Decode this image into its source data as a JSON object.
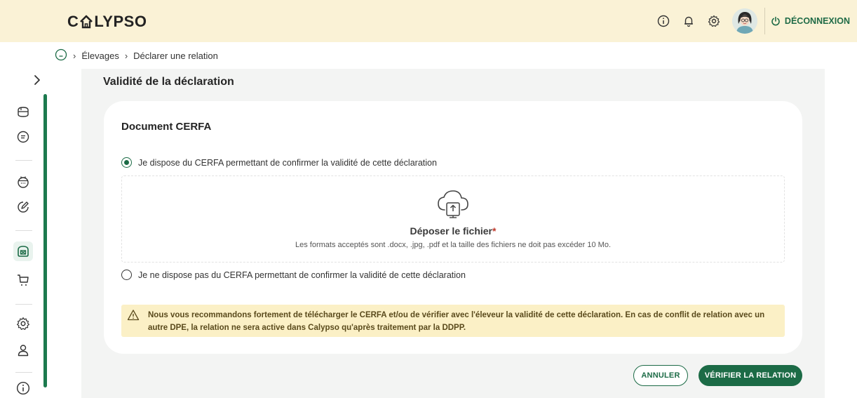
{
  "app": {
    "logo_left": "C",
    "logo_right": "LYPSO"
  },
  "header": {
    "logout_label": "DÉCONNEXION",
    "icons": [
      "info-icon",
      "bell-icon",
      "gear-icon",
      "avatar",
      "power-icon"
    ]
  },
  "breadcrumb": {
    "items": [
      "Élevages",
      "Déclarer une relation"
    ]
  },
  "sidebar": {
    "icons": [
      "chevron-right-icon",
      "briefcase-icon",
      "document-icon",
      "calendar-icon",
      "edit-icon",
      "barn-icon",
      "cart-icon",
      "gear-icon",
      "user-icon",
      "info-icon"
    ]
  },
  "main": {
    "section_title": "Validité de la déclaration",
    "card": {
      "title": "Document CERFA",
      "option_yes": "Je dispose du CERFA permettant de confirmer la validité de cette déclaration",
      "option_no": "Je ne dispose pas du CERFA permettant de confirmer la validité de cette déclaration",
      "selected": "yes",
      "dropzone": {
        "title": "Déposer le fichier",
        "required_mark": "*",
        "hint": "Les formats acceptés sont .docx, .jpg, .pdf et la taille des fichiers ne doit pas excéder 10 Mo."
      },
      "warning": "Nous vous recommandons fortement de télécharger le CERFA et/ou de vérifier avec l'éleveur la validité de cette déclaration. En cas de conflit de relation avec un autre DPE, la relation ne sera active dans Calypso qu'après traitement par la DDPP."
    },
    "buttons": {
      "cancel": "ANNULER",
      "verify": "VÉRIFIER LA RELATION"
    }
  },
  "colors": {
    "header_bg": "#faf2d6",
    "accent": "#1c6b46",
    "warning_bg": "#fbf0c6",
    "page_bg": "#f3f4f3"
  }
}
